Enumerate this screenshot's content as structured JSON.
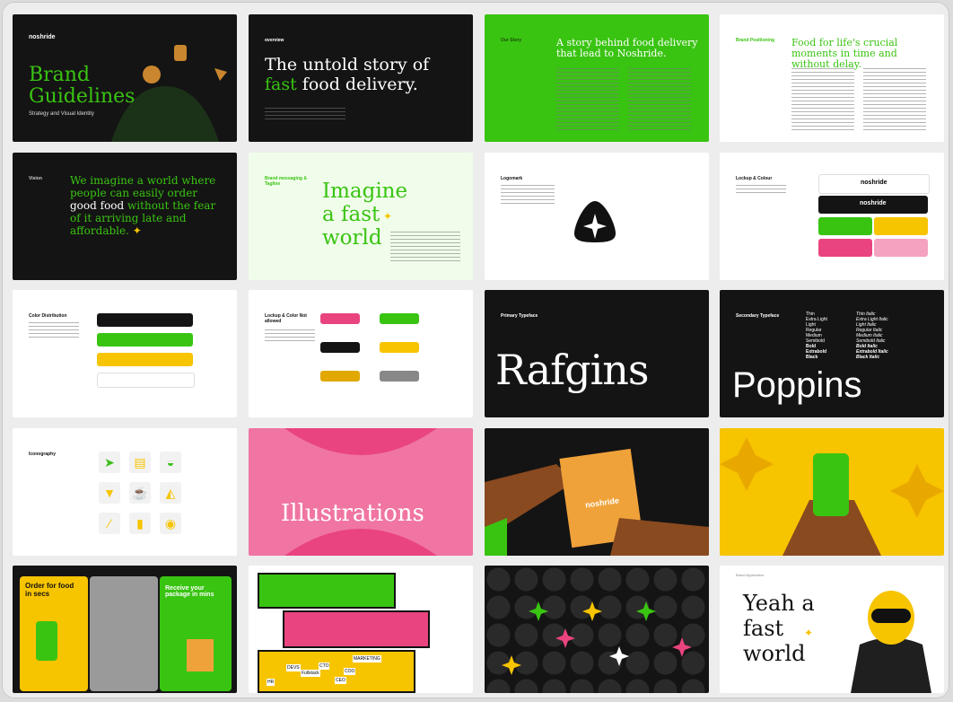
{
  "brand": "noshride",
  "cards": {
    "c1": {
      "title": "Brand Guidelines",
      "subtitle": "Strategy and Visual Identity"
    },
    "c2": {
      "label": "overview",
      "headline_1": "The untold story of",
      "headline_accent": "fast",
      "headline_2": "food delivery."
    },
    "c3": {
      "label": "Our Story",
      "headline": "A story behind food delivery that lead to Noshride."
    },
    "c4": {
      "label": "Brand Positioning",
      "headline": "Food for life's crucial moments in time and without delay."
    },
    "c5": {
      "label": "Vision",
      "text_1": "We imagine a world where people can easily order",
      "text_accent": "good food",
      "text_2": "without the fear of it arriving late and affordable."
    },
    "c6": {
      "label": "Brand messaging & Tagline",
      "headline": "Imagine a fast world"
    },
    "c7": {
      "label": "Logomark"
    },
    "c8": {
      "label": "Lockup & Colour"
    },
    "c9": {
      "label": "Color Distribution"
    },
    "c10": {
      "label": "Lockup & Color Not allowed"
    },
    "c11": {
      "label": "Primary Typeface",
      "font_name": "Rafgins"
    },
    "c12": {
      "label": "Secondary Typeface",
      "font_name": "Poppins",
      "weights": [
        "Thin",
        "Extra Light",
        "Light",
        "Regular",
        "Medium",
        "Semibold",
        "Bold",
        "Extrabold",
        "Black"
      ],
      "italics": [
        "Thin Italic",
        "Extra Light Italic",
        "Light Italic",
        "Regular Italic",
        "Medium Italic",
        "Semibold Italic",
        "Bold Italic",
        "Extrabold Italic",
        "Black Italic"
      ]
    },
    "c13": {
      "label": "Iconography"
    },
    "c14": {
      "title": "Illustrations"
    },
    "c15": {
      "bag_logo": "noshride"
    },
    "c17": {
      "promo_1": "Order for food in secs",
      "promo_2": "Receive your package in mins"
    },
    "c18": {
      "signs": [
        "DEVS",
        "Fullstack",
        "CTO",
        "COO",
        "MARKETING",
        "CEO",
        "HR"
      ]
    },
    "c20": {
      "label": "Brand Application",
      "headline": "Yeah a fast world"
    }
  },
  "colors": {
    "green": "#39c412",
    "yellow": "#f7c400",
    "pink": "#e9447f",
    "black": "#141414",
    "orange": "#f0a23a"
  }
}
